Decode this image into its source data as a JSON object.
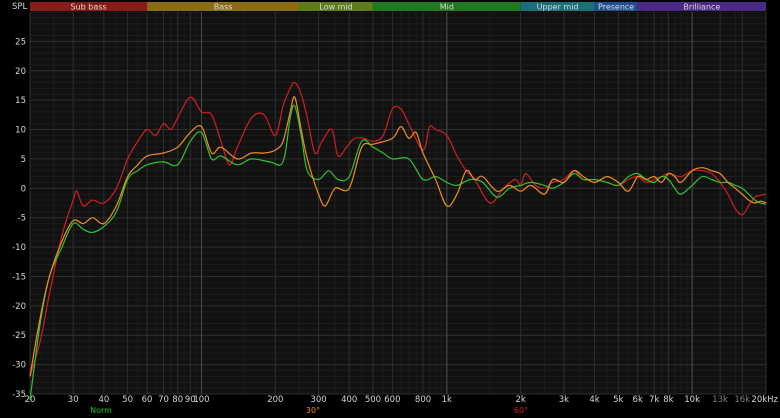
{
  "chart_data": {
    "type": "line",
    "ylabel": "SPL",
    "x_scale": "log",
    "xlim": [
      20,
      20000
    ],
    "ylim": [
      -35,
      30
    ],
    "grid": true,
    "y_ticks": [
      25,
      20,
      15,
      10,
      5,
      0,
      -5,
      -10,
      -15,
      -20,
      -25,
      -30,
      -35
    ],
    "x_ticks": [
      {
        "value": 20,
        "label": "20"
      },
      {
        "value": 30,
        "label": "30"
      },
      {
        "value": 40,
        "label": "40"
      },
      {
        "value": 50,
        "label": "50"
      },
      {
        "value": 60,
        "label": "60"
      },
      {
        "value": 70,
        "label": "70"
      },
      {
        "value": 80,
        "label": "80"
      },
      {
        "value": 90,
        "label": "90"
      },
      {
        "value": 100,
        "label": "100"
      },
      {
        "value": 200,
        "label": "200"
      },
      {
        "value": 300,
        "label": "300"
      },
      {
        "value": 400,
        "label": "400"
      },
      {
        "value": 500,
        "label": "500"
      },
      {
        "value": 600,
        "label": "600"
      },
      {
        "value": 800,
        "label": "800"
      },
      {
        "value": 1000,
        "label": "1k"
      },
      {
        "value": 2000,
        "label": "2k"
      },
      {
        "value": 3000,
        "label": "3k"
      },
      {
        "value": 4000,
        "label": "4k"
      },
      {
        "value": 5000,
        "label": "5k"
      },
      {
        "value": 6000,
        "label": "6k"
      },
      {
        "value": 7000,
        "label": "7k"
      },
      {
        "value": 8000,
        "label": "8k"
      },
      {
        "value": 10000,
        "label": "10k"
      },
      {
        "value": 13000,
        "label": "13k",
        "dim": true
      },
      {
        "value": 16000,
        "label": "16k",
        "dim": true
      },
      {
        "value": 20000,
        "label": "20kHz"
      }
    ],
    "bands": [
      {
        "name": "Sub bass",
        "from": 20,
        "to": 60,
        "color": "#8b1a1a"
      },
      {
        "name": "Bass",
        "from": 60,
        "to": 250,
        "color": "#8a6d14"
      },
      {
        "name": "Low mid",
        "from": 250,
        "to": 500,
        "color": "#5f7d18"
      },
      {
        "name": "Mid",
        "from": 500,
        "to": 2000,
        "color": "#1f7a22"
      },
      {
        "name": "Upper mid",
        "from": 2000,
        "to": 4000,
        "color": "#1b6f78"
      },
      {
        "name": "Presence",
        "from": 4000,
        "to": 6000,
        "color": "#1f4f93"
      },
      {
        "name": "Brilliance",
        "from": 6000,
        "to": 20000,
        "color": "#4b2a86"
      }
    ],
    "series": [
      {
        "name": "Norm",
        "color": "#2fc22f",
        "points": [
          [
            20,
            -36
          ],
          [
            22,
            -23
          ],
          [
            24,
            -15
          ],
          [
            27,
            -10
          ],
          [
            30,
            -6
          ],
          [
            33,
            -7
          ],
          [
            36,
            -7.5
          ],
          [
            40,
            -6.5
          ],
          [
            45,
            -4
          ],
          [
            50,
            1.5
          ],
          [
            55,
            3
          ],
          [
            60,
            4
          ],
          [
            70,
            4.5
          ],
          [
            80,
            4
          ],
          [
            90,
            8
          ],
          [
            100,
            9.5
          ],
          [
            110,
            5
          ],
          [
            120,
            5.5
          ],
          [
            140,
            4
          ],
          [
            160,
            5
          ],
          [
            190,
            4.5
          ],
          [
            215,
            4.5
          ],
          [
            230,
            12
          ],
          [
            240,
            14
          ],
          [
            255,
            9
          ],
          [
            270,
            3
          ],
          [
            300,
            1.5
          ],
          [
            330,
            3
          ],
          [
            360,
            1.5
          ],
          [
            400,
            2
          ],
          [
            450,
            8
          ],
          [
            500,
            7
          ],
          [
            550,
            6
          ],
          [
            600,
            5
          ],
          [
            700,
            5
          ],
          [
            800,
            1.5
          ],
          [
            900,
            2
          ],
          [
            1000,
            1
          ],
          [
            1100,
            0.5
          ],
          [
            1250,
            1.5
          ],
          [
            1400,
            1
          ],
          [
            1600,
            -1.5
          ],
          [
            1800,
            0
          ],
          [
            2000,
            0.5
          ],
          [
            2200,
            1
          ],
          [
            2500,
            0.5
          ],
          [
            2700,
            0
          ],
          [
            3000,
            1
          ],
          [
            3300,
            2.5
          ],
          [
            3600,
            1.5
          ],
          [
            4000,
            1.5
          ],
          [
            4500,
            1
          ],
          [
            5000,
            0.5
          ],
          [
            5500,
            2
          ],
          [
            6000,
            2.5
          ],
          [
            6500,
            1.5
          ],
          [
            7000,
            1
          ],
          [
            7500,
            2
          ],
          [
            8000,
            1.5
          ],
          [
            8500,
            0
          ],
          [
            9000,
            -1
          ],
          [
            10000,
            0.5
          ],
          [
            11000,
            2
          ],
          [
            12000,
            1.5
          ],
          [
            13000,
            1
          ],
          [
            14000,
            1
          ],
          [
            15000,
            0.5
          ],
          [
            16000,
            0
          ],
          [
            17000,
            -1
          ],
          [
            18000,
            -2
          ],
          [
            19000,
            -2.5
          ],
          [
            20000,
            -2.7
          ]
        ]
      },
      {
        "name": "30°",
        "color": "#f08f1f",
        "points": [
          [
            20,
            -32
          ],
          [
            22,
            -22
          ],
          [
            24,
            -15
          ],
          [
            27,
            -9
          ],
          [
            30,
            -5.5
          ],
          [
            33,
            -6
          ],
          [
            36,
            -5
          ],
          [
            40,
            -6
          ],
          [
            45,
            -3
          ],
          [
            50,
            2
          ],
          [
            55,
            4
          ],
          [
            60,
            5.5
          ],
          [
            70,
            6
          ],
          [
            80,
            7
          ],
          [
            90,
            9.5
          ],
          [
            100,
            10.5
          ],
          [
            110,
            6
          ],
          [
            120,
            7
          ],
          [
            140,
            5
          ],
          [
            160,
            6
          ],
          [
            180,
            6
          ],
          [
            200,
            6.5
          ],
          [
            215,
            8
          ],
          [
            230,
            13
          ],
          [
            240,
            15.5
          ],
          [
            255,
            10
          ],
          [
            270,
            5
          ],
          [
            300,
            -1
          ],
          [
            320,
            -3
          ],
          [
            350,
            0
          ],
          [
            400,
            0
          ],
          [
            450,
            7
          ],
          [
            500,
            7.5
          ],
          [
            600,
            8.5
          ],
          [
            650,
            10.5
          ],
          [
            700,
            8.5
          ],
          [
            750,
            9.5
          ],
          [
            800,
            6
          ],
          [
            900,
            1.5
          ],
          [
            1000,
            -3
          ],
          [
            1100,
            -1
          ],
          [
            1200,
            3
          ],
          [
            1300,
            1.5
          ],
          [
            1400,
            2
          ],
          [
            1600,
            -0.5
          ],
          [
            1800,
            0.5
          ],
          [
            2000,
            -0.5
          ],
          [
            2200,
            0.5
          ],
          [
            2500,
            -1
          ],
          [
            2700,
            1.5
          ],
          [
            3000,
            1
          ],
          [
            3300,
            3
          ],
          [
            3600,
            2
          ],
          [
            4000,
            1
          ],
          [
            4500,
            2
          ],
          [
            5000,
            1
          ],
          [
            5500,
            -0.5
          ],
          [
            6000,
            2
          ],
          [
            6500,
            1.5
          ],
          [
            7000,
            2
          ],
          [
            7500,
            1
          ],
          [
            8000,
            2.5
          ],
          [
            8500,
            2
          ],
          [
            9000,
            1
          ],
          [
            10000,
            3
          ],
          [
            11000,
            3.5
          ],
          [
            12000,
            3
          ],
          [
            13000,
            2.5
          ],
          [
            14000,
            1
          ],
          [
            15000,
            0
          ],
          [
            16000,
            -1
          ],
          [
            17000,
            -2
          ],
          [
            18000,
            -2.5
          ],
          [
            19000,
            -2.2
          ],
          [
            20000,
            -2.5
          ]
        ]
      },
      {
        "name": "60°",
        "color": "#d11f1f",
        "points": [
          [
            20,
            -32
          ],
          [
            22,
            -26
          ],
          [
            24,
            -18
          ],
          [
            27,
            -8
          ],
          [
            30,
            -2
          ],
          [
            31,
            -0.5
          ],
          [
            33,
            -3
          ],
          [
            36,
            -2
          ],
          [
            40,
            -2.5
          ],
          [
            45,
            0
          ],
          [
            50,
            5
          ],
          [
            55,
            8
          ],
          [
            60,
            10
          ],
          [
            65,
            9
          ],
          [
            70,
            11
          ],
          [
            75,
            10
          ],
          [
            80,
            12
          ],
          [
            90,
            15.5
          ],
          [
            100,
            13
          ],
          [
            110,
            12.5
          ],
          [
            120,
            8
          ],
          [
            130,
            4
          ],
          [
            140,
            7
          ],
          [
            160,
            12
          ],
          [
            180,
            12.5
          ],
          [
            200,
            9
          ],
          [
            215,
            14
          ],
          [
            230,
            17
          ],
          [
            240,
            18
          ],
          [
            255,
            16
          ],
          [
            270,
            12
          ],
          [
            290,
            6
          ],
          [
            310,
            8
          ],
          [
            340,
            10
          ],
          [
            360,
            5.5
          ],
          [
            390,
            7
          ],
          [
            420,
            8.5
          ],
          [
            460,
            8.5
          ],
          [
            500,
            8
          ],
          [
            550,
            9
          ],
          [
            600,
            13.5
          ],
          [
            650,
            13.5
          ],
          [
            700,
            11
          ],
          [
            800,
            6.5
          ],
          [
            850,
            10.5
          ],
          [
            900,
            10
          ],
          [
            1000,
            9
          ],
          [
            1100,
            5.5
          ],
          [
            1200,
            3
          ],
          [
            1300,
            1.5
          ],
          [
            1500,
            -2.5
          ],
          [
            1700,
            0
          ],
          [
            1900,
            1.5
          ],
          [
            2000,
            0.5
          ],
          [
            2100,
            2.5
          ],
          [
            2300,
            0.5
          ],
          [
            2500,
            0
          ],
          [
            2700,
            1
          ],
          [
            3000,
            1.5
          ],
          [
            3300,
            3
          ],
          [
            3600,
            1.5
          ],
          [
            4000,
            1.5
          ],
          [
            4500,
            1
          ],
          [
            5000,
            0.5
          ],
          [
            5500,
            1.5
          ],
          [
            6000,
            2
          ],
          [
            6500,
            1
          ],
          [
            7000,
            1.5
          ],
          [
            7500,
            2
          ],
          [
            8000,
            2.5
          ],
          [
            9000,
            2
          ],
          [
            10000,
            3
          ],
          [
            11000,
            3
          ],
          [
            12000,
            2.5
          ],
          [
            13000,
            1
          ],
          [
            14000,
            -1
          ],
          [
            15000,
            -3.5
          ],
          [
            16000,
            -4.5
          ],
          [
            17000,
            -3
          ],
          [
            18000,
            -1.5
          ],
          [
            19000,
            -1.2
          ],
          [
            20000,
            -1
          ]
        ]
      }
    ]
  }
}
